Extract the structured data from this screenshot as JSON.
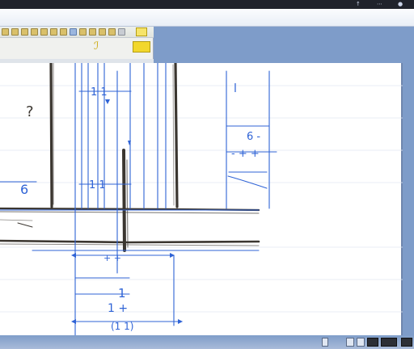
{
  "window": {
    "accent": "#7e9cc9",
    "canvas_bg": "#ffffff",
    "pencil": "#3b3630",
    "ink": "#2f63d6"
  },
  "topbar": {
    "tray_glyphs": [
      "↑",
      "⋯",
      "●"
    ]
  },
  "toolbar": {
    "buttons": [
      "pencil-icon",
      "eraser-icon",
      "line-icon",
      "rectangle-icon",
      "ellipse-icon",
      "fill-icon",
      "text-icon",
      "select-icon",
      "move-icon",
      "zoom-icon",
      "undo-icon",
      "redo-icon",
      "grid-icon",
      "layer-icon"
    ],
    "hint_glyph": "ℐ"
  },
  "drawing": {
    "labels": [
      {
        "id": "lbl-a",
        "text": "1 1"
      },
      {
        "id": "lbl-b",
        "text": "l"
      },
      {
        "id": "lbl-c",
        "text": "6"
      },
      {
        "id": "lbl-d",
        "text": "6 -"
      },
      {
        "id": "lbl-e",
        "text": "- + +"
      },
      {
        "id": "lbl-f",
        "text": "1 1"
      },
      {
        "id": "lbl-g",
        "text": "?"
      },
      {
        "id": "lbl-h",
        "text": "+ +"
      },
      {
        "id": "lbl-i",
        "text": "1"
      },
      {
        "id": "lbl-j",
        "text": "1 +"
      },
      {
        "id": "lbl-k",
        "text": "(1 1)"
      }
    ]
  },
  "statusbar": {
    "icons": [
      "page-icon",
      "zoom-out-icon",
      "fit-icon",
      "zoom-in-icon",
      "view-icon",
      "settings-icon"
    ]
  }
}
